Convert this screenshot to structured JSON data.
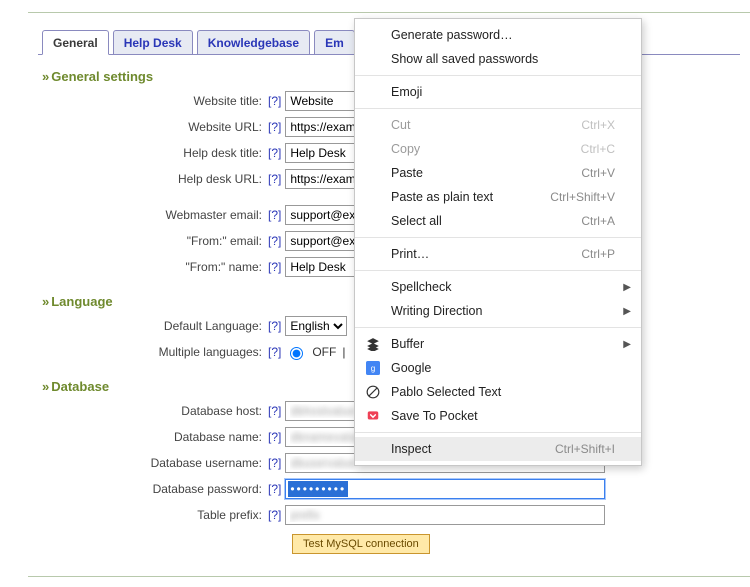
{
  "tabs": {
    "general": "General",
    "helpdesk": "Help Desk",
    "knowledgebase": "Knowledgebase",
    "email": "Em"
  },
  "sections": {
    "general_settings": "General settings",
    "language": "Language",
    "database": "Database"
  },
  "labels": {
    "website_title": "Website title:",
    "website_url": "Website URL:",
    "helpdesk_title": "Help desk title:",
    "helpdesk_url": "Help desk URL:",
    "webmaster_email": "Webmaster email:",
    "from_email": "\"From:\" email:",
    "from_name": "\"From:\" name:",
    "default_language": "Default Language:",
    "multiple_languages": "Multiple languages:",
    "db_host": "Database host:",
    "db_name": "Database name:",
    "db_user": "Database username:",
    "db_pass": "Database password:",
    "table_prefix": "Table prefix:",
    "help": "[?]",
    "test_link": "Tes",
    "off": "OFF",
    "o": "O"
  },
  "values": {
    "website_title": "Website",
    "website_url": "https://exampl",
    "helpdesk_title": "Help Desk",
    "helpdesk_url": "https://exampl",
    "webmaster_email": "support@exam",
    "from_email": "support@exam",
    "from_name": "Help Desk",
    "default_language": "English",
    "db_host_obscured": "dbhostvalue",
    "db_name_obscured": "dbnamevalue",
    "db_user_obscured": "dbuservalue",
    "db_pass_dots": "•••••••••",
    "table_prefix_obscured": "prefix"
  },
  "buttons": {
    "test_mysql": "Test MySQL connection"
  },
  "context_menu": {
    "generate_password": "Generate password…",
    "show_saved": "Show all saved passwords",
    "emoji": "Emoji",
    "cut": "Cut",
    "copy": "Copy",
    "paste": "Paste",
    "paste_plain": "Paste as plain text",
    "select_all": "Select all",
    "print": "Print…",
    "spellcheck": "Spellcheck",
    "writing_direction": "Writing Direction",
    "buffer": "Buffer",
    "google": "Google",
    "pablo": "Pablo Selected Text",
    "pocket": "Save To Pocket",
    "inspect": "Inspect",
    "shortcuts": {
      "cut": "Ctrl+X",
      "copy": "Ctrl+C",
      "paste": "Ctrl+V",
      "paste_plain": "Ctrl+Shift+V",
      "select_all": "Ctrl+A",
      "print": "Ctrl+P",
      "inspect": "Ctrl+Shift+I"
    }
  }
}
